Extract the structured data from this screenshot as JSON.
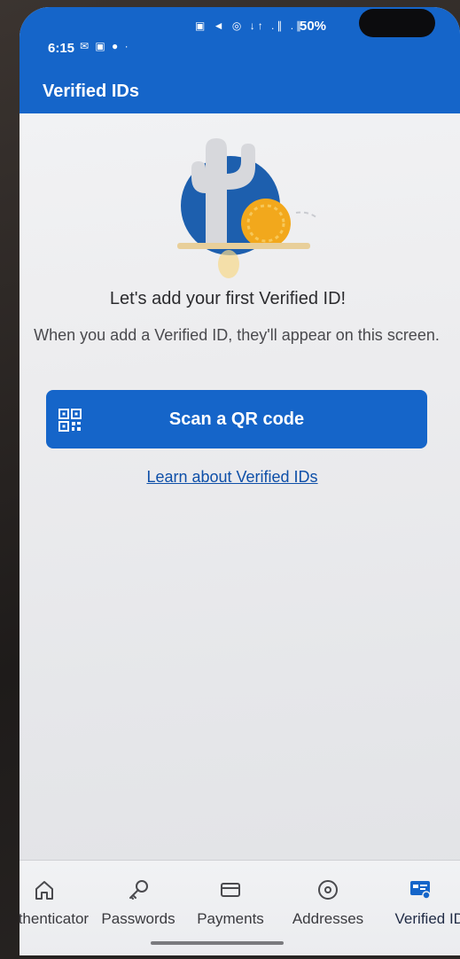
{
  "status_bar": {
    "time": "6:15",
    "left_icons": "✉ ▣ ● ·",
    "right_icons": "▣ ◄ ◎ ↓↑ .∥ .∥",
    "battery": "50%"
  },
  "app_bar": {
    "title": "Verified IDs"
  },
  "empty_state": {
    "headline": "Let's add your first Verified ID!",
    "description": "When you add a Verified ID, they'll appear on this screen."
  },
  "scan_button": {
    "label": "Scan a QR code",
    "icon": "qr-code-icon"
  },
  "learn_link": {
    "label": "Learn about Verified IDs"
  },
  "bottom_nav": {
    "items": [
      {
        "label": "Authenticator",
        "icon": "home-icon"
      },
      {
        "label": "Passwords",
        "icon": "key-icon"
      },
      {
        "label": "Payments",
        "icon": "card-icon"
      },
      {
        "label": "Addresses",
        "icon": "location-pin-icon"
      },
      {
        "label": "Verified IDs",
        "icon": "verified-id-icon",
        "active": true
      }
    ]
  },
  "colors": {
    "accent": "#1565c9",
    "background": "#eceef0",
    "link": "#0e4fa8",
    "illustration_sun": "#f2a81c",
    "illustration_circle": "#1d5fae"
  }
}
